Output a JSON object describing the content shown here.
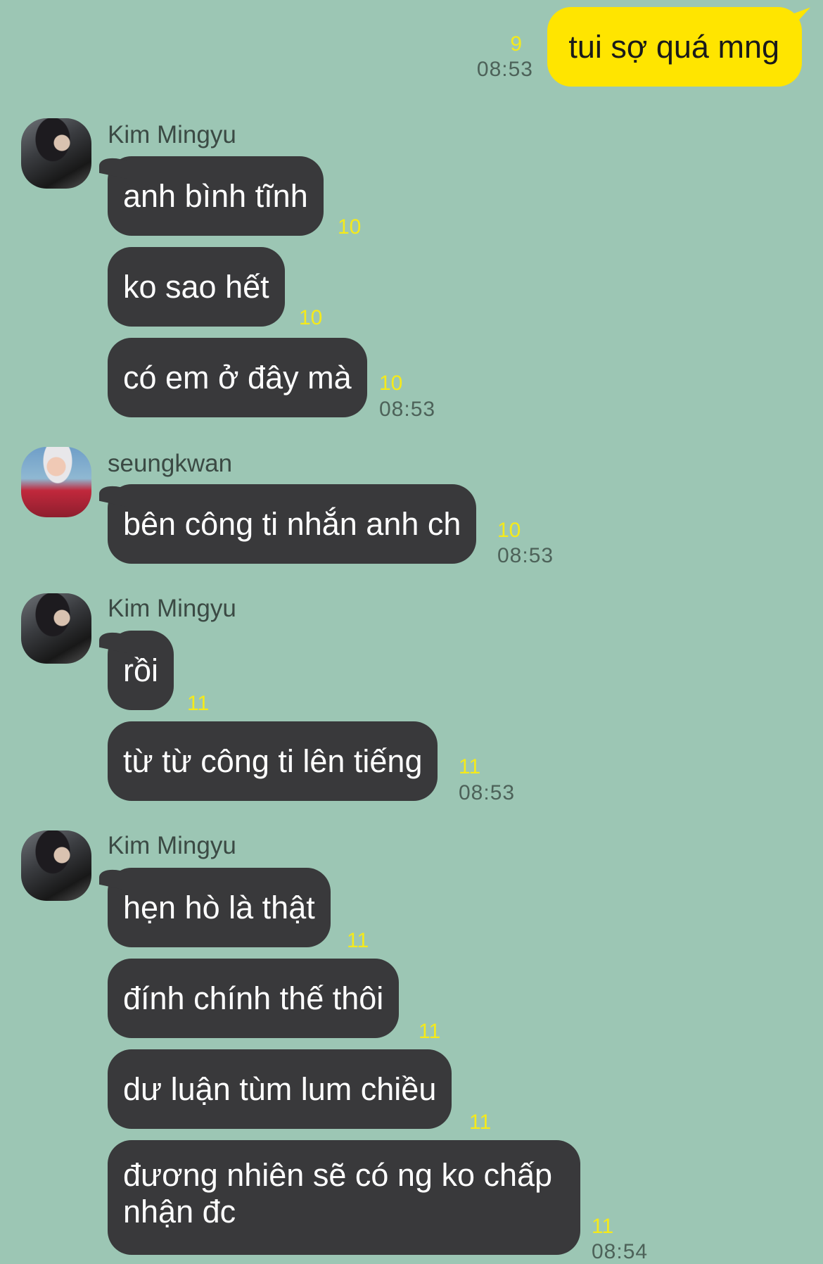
{
  "colors": {
    "background": "#9cc6b4",
    "outgoing_bubble": "#ffe500",
    "incoming_bubble": "#39393b",
    "unread_count": "#f5ea1a"
  },
  "outgoing": {
    "text": "tui sợ quá mng",
    "count": "9",
    "time": "08:53"
  },
  "groups": [
    {
      "sender": "Kim Mingyu",
      "avatar": "mingyu-avatar",
      "messages": [
        {
          "text": "anh bình tĩnh",
          "count": "10",
          "time": ""
        },
        {
          "text": "ko sao hết",
          "count": "10",
          "time": ""
        },
        {
          "text": "có em ở đây mà",
          "count": "10",
          "time": "08:53"
        }
      ]
    },
    {
      "sender": "seungkwan",
      "avatar": "seungkwan-avatar",
      "messages": [
        {
          "text": "bên công ti nhắn anh ch",
          "count": "10",
          "time": "08:53"
        }
      ]
    },
    {
      "sender": "Kim Mingyu",
      "avatar": "mingyu-avatar",
      "messages": [
        {
          "text": "rồi",
          "count": "11",
          "time": ""
        },
        {
          "text": "từ từ công ti lên tiếng",
          "count": "11",
          "time": "08:53"
        }
      ]
    },
    {
      "sender": "Kim Mingyu",
      "avatar": "mingyu-avatar",
      "messages": [
        {
          "text": "hẹn hò là thật",
          "count": "11",
          "time": ""
        },
        {
          "text": "đính chính thế thôi",
          "count": "11",
          "time": ""
        },
        {
          "text": "dư luận tùm lum chiều",
          "count": "11",
          "time": ""
        },
        {
          "text": "đương nhiên sẽ có ng ko chấp nhận đc",
          "count": "11",
          "time": "08:54"
        }
      ]
    }
  ]
}
